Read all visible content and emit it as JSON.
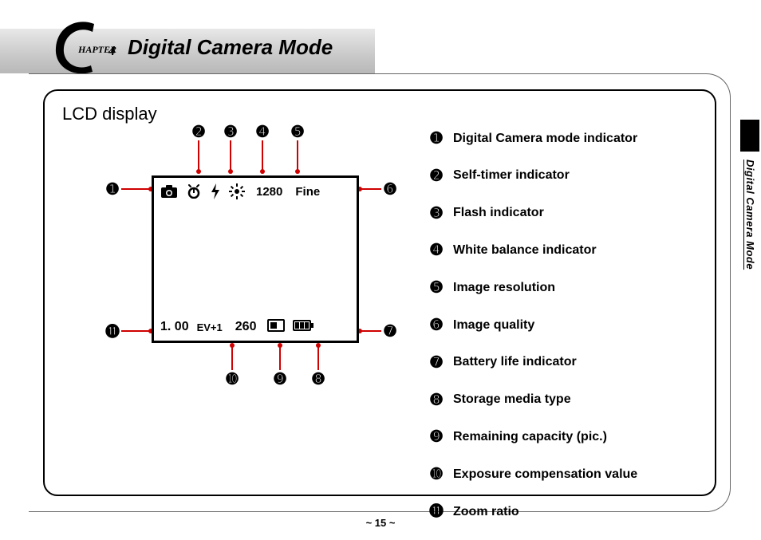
{
  "chapter": {
    "number_label": "HAPTER",
    "number": "4",
    "title": "Digital Camera Mode"
  },
  "section": {
    "title": "LCD display"
  },
  "lcd": {
    "image_resolution": "1280",
    "image_quality": "Fine",
    "zoom_ratio": "1. 00",
    "ev": "EV+1",
    "remaining": "260"
  },
  "callouts": {
    "1": "➊",
    "2": "➋",
    "3": "➌",
    "4": "➍",
    "5": "➎",
    "6": "➏",
    "7": "➐",
    "8": "➑",
    "9": "➒",
    "10": "➓",
    "11": "⓫"
  },
  "legend": [
    {
      "n": "➊",
      "label": "Digital Camera mode indicator"
    },
    {
      "n": "➋",
      "label": "Self-timer indicator"
    },
    {
      "n": "➌",
      "label": "Flash indicator"
    },
    {
      "n": "➍",
      "label": "White balance indicator"
    },
    {
      "n": "➎",
      "label": "Image resolution"
    },
    {
      "n": "➏",
      "label": "Image quality"
    },
    {
      "n": "➐",
      "label": "Battery life indicator"
    },
    {
      "n": "➑",
      "label": "Storage media type"
    },
    {
      "n": "➒",
      "label": "Remaining capacity (pic.)"
    },
    {
      "n": "➓",
      "label": "Exposure compensation value"
    },
    {
      "n": "⓫",
      "label": "Zoom ratio"
    }
  ],
  "side_label": "Digital Camera Mode",
  "page_number": "~ 15 ~"
}
